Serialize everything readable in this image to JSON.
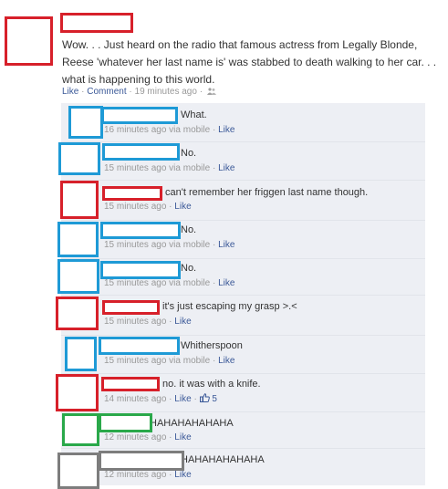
{
  "post": {
    "text": "Wow. . . Just heard on the radio that famous actress from Legally Blonde, Reese 'whatever her last name is' was stabbed to death walking to her car. . . what is happening to this world.",
    "like_label": "Like",
    "comment_label": "Comment",
    "time": "19 minutes ago",
    "separator": "·"
  },
  "comments": [
    {
      "text": "What.",
      "time": "16 minutes ago",
      "via": "via mobile",
      "like": "Like"
    },
    {
      "text": "No.",
      "time": "15 minutes ago",
      "via": "via mobile",
      "like": "Like"
    },
    {
      "text": "can't remember her friggen last name though.",
      "time": "15 minutes ago",
      "via": "",
      "like": "Like"
    },
    {
      "text": "No.",
      "time": "15 minutes ago",
      "via": "via mobile",
      "like": "Like"
    },
    {
      "text": "No.",
      "time": "15 minutes ago",
      "via": "via mobile",
      "like": "Like"
    },
    {
      "text": "it's just escaping my grasp >.<",
      "time": "15 minutes ago",
      "via": "",
      "like": "Like"
    },
    {
      "text": "Whitherspoon",
      "time": "15 minutes ago",
      "via": "via mobile",
      "like": "Like"
    },
    {
      "text": "no. it was with a knife.",
      "time": "14 minutes ago",
      "via": "",
      "like": "Like",
      "like_count": "5"
    },
    {
      "text": "HAHAHAHAHAHA",
      "time": "12 minutes ago",
      "via": "",
      "like": "Like"
    },
    {
      "text": "HAHAHAHAHAHA",
      "time": "12 minutes ago",
      "via": "",
      "like": "Like"
    }
  ],
  "colors": {
    "redaction_red": "#d7202a",
    "redaction_blue": "#1e9ad6",
    "redaction_green": "#2aa84a",
    "redaction_gray": "#7d7d7d",
    "link": "#3b5998",
    "comment_bg": "#edeff4"
  },
  "icons": [
    "people-icon",
    "thumbs-up-icon"
  ]
}
